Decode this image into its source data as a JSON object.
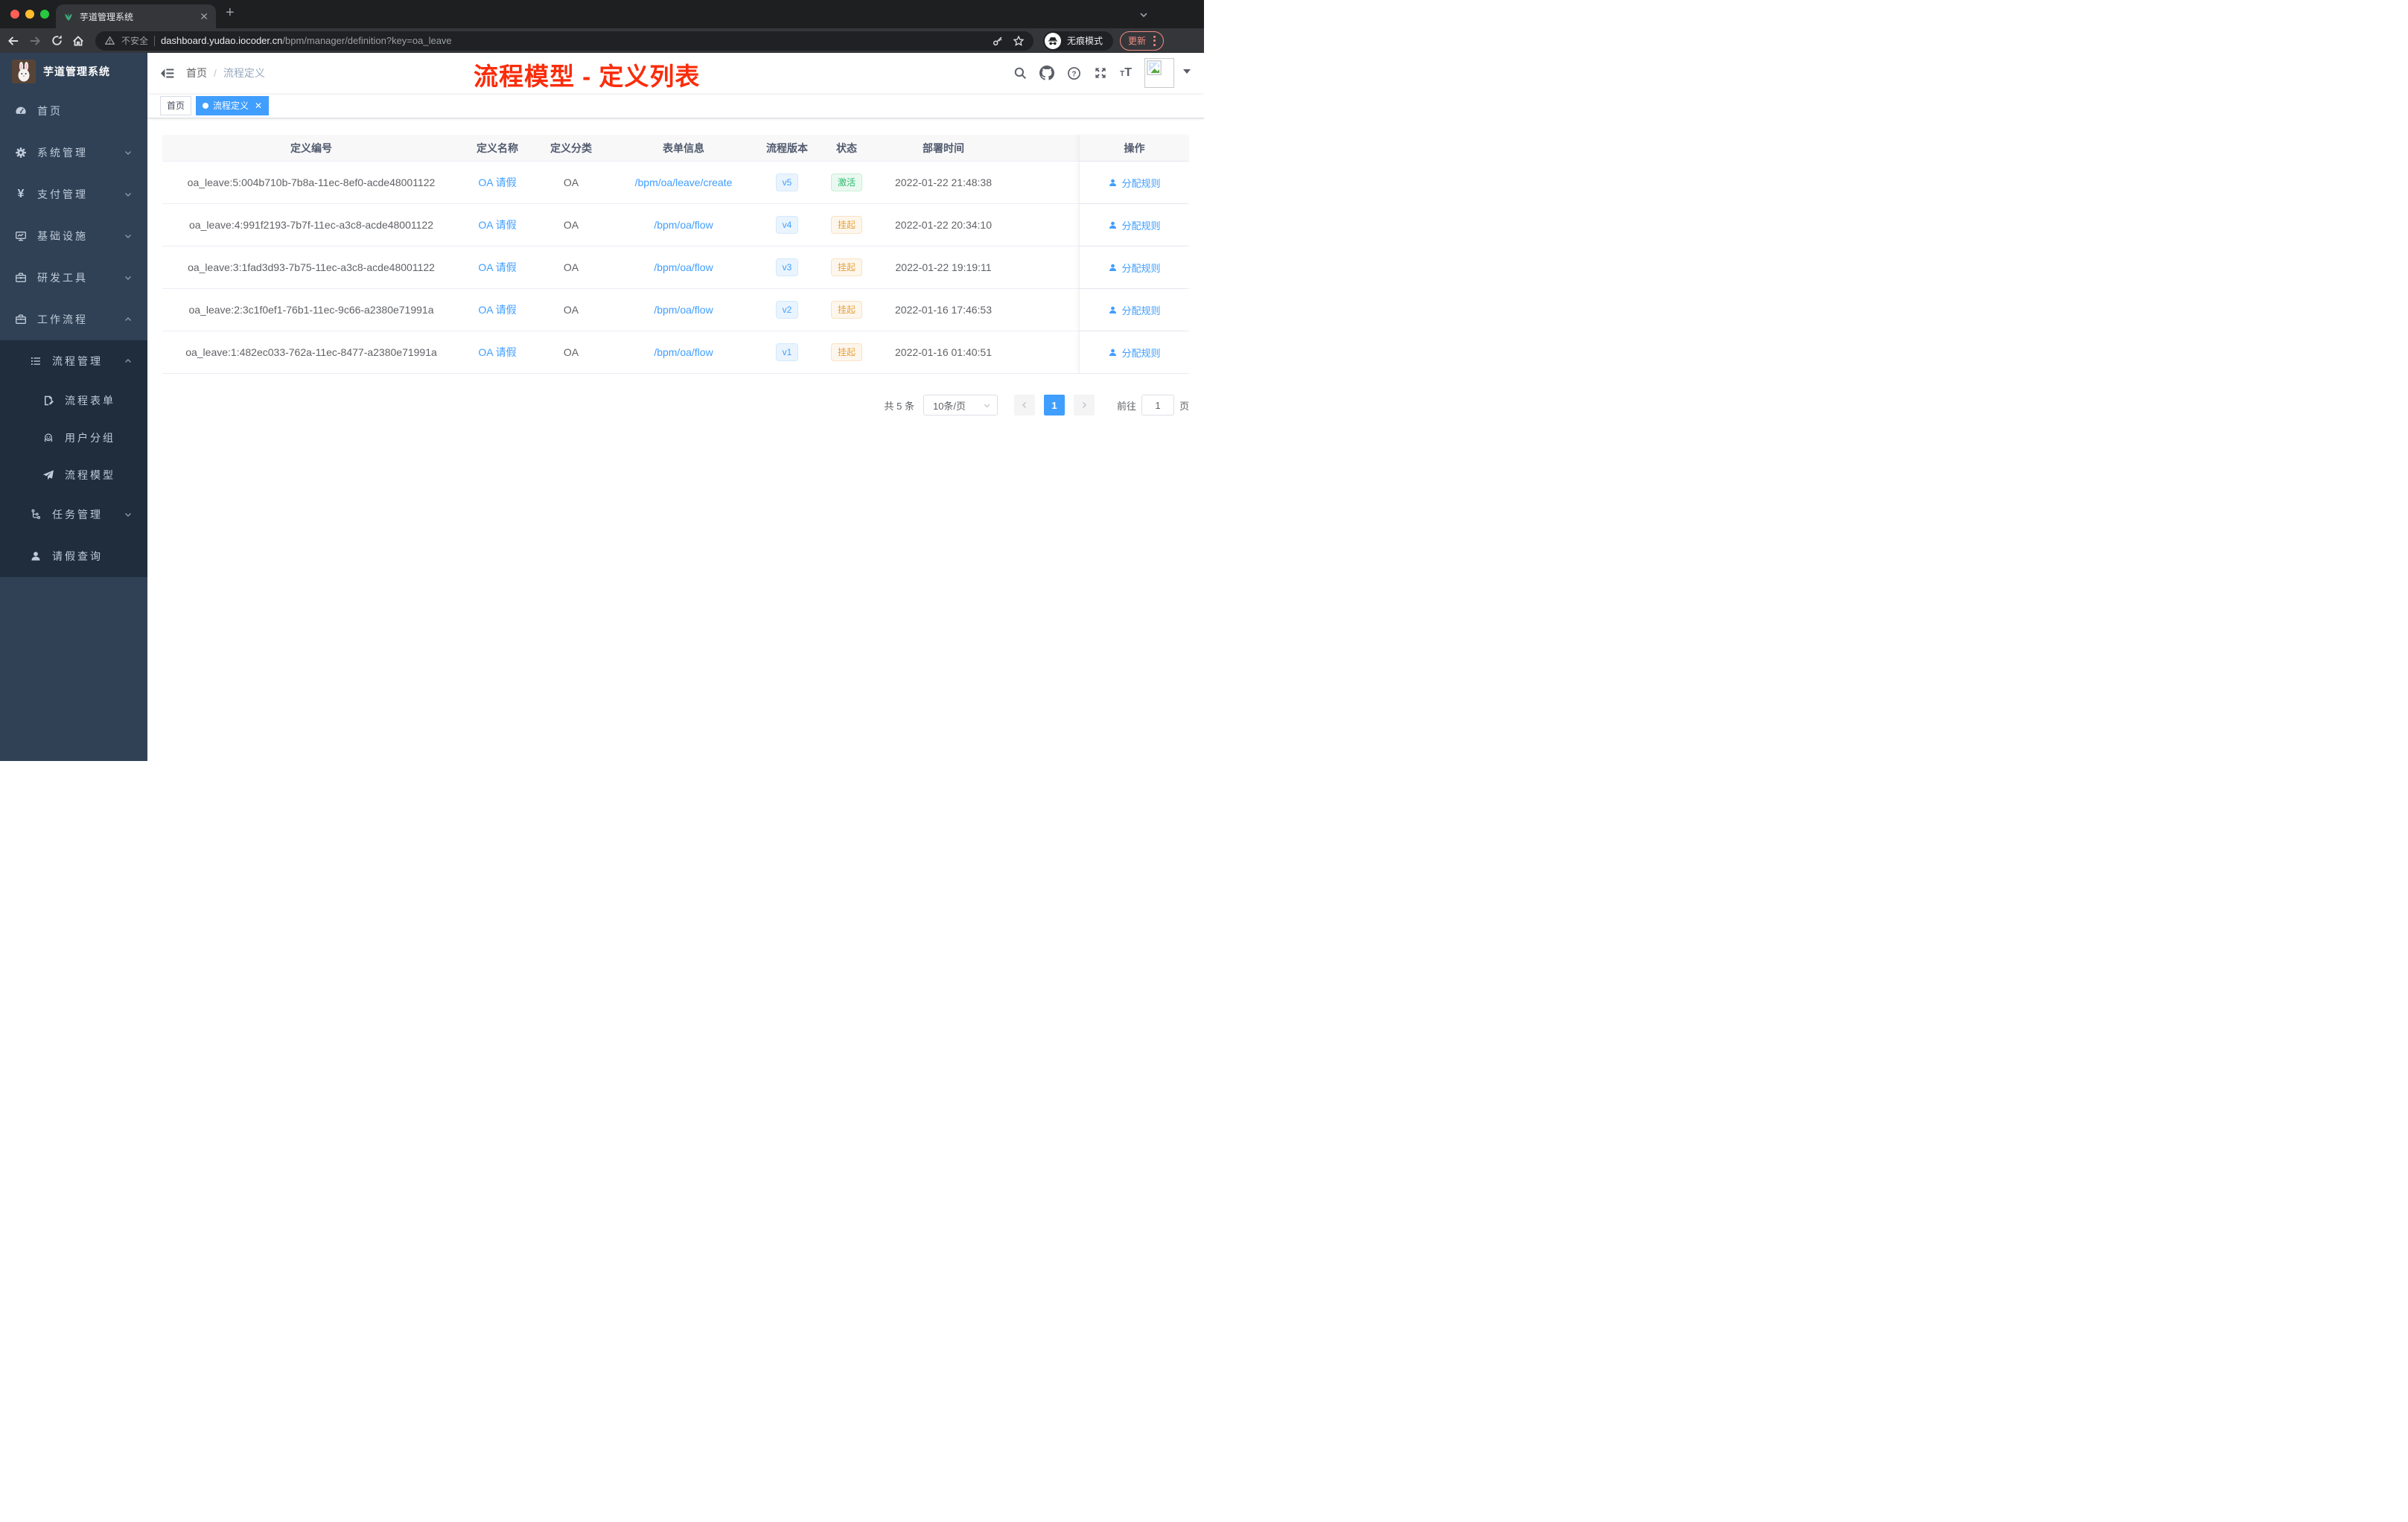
{
  "browser": {
    "tab_title": "芋道管理系统",
    "security_label": "不安全",
    "url_host": "dashboard.yudao.iocoder.cn",
    "url_path": "/bpm/manager/definition?key=oa_leave",
    "incognito_label": "无痕模式",
    "update_label": "更新"
  },
  "sidebar": {
    "title": "芋道管理系统",
    "items": [
      {
        "label": "首页",
        "icon": "dashboard-icon",
        "level": 0
      },
      {
        "label": "系统管理",
        "icon": "gear-icon",
        "level": 0,
        "arrow": "down"
      },
      {
        "label": "支付管理",
        "icon": "yen-icon",
        "level": 0,
        "arrow": "down"
      },
      {
        "label": "基础设施",
        "icon": "monitor-icon",
        "level": 0,
        "arrow": "down"
      },
      {
        "label": "研发工具",
        "icon": "toolbox-icon",
        "level": 0,
        "arrow": "down"
      },
      {
        "label": "工作流程",
        "icon": "briefcase-icon",
        "level": 0,
        "arrow": "up"
      },
      {
        "label": "流程管理",
        "icon": "list-icon",
        "level": 1,
        "arrow": "up"
      },
      {
        "label": "流程表单",
        "icon": "form-icon",
        "level": 2
      },
      {
        "label": "用户分组",
        "icon": "robot-icon",
        "level": 2
      },
      {
        "label": "流程模型",
        "icon": "send-icon",
        "level": 2
      },
      {
        "label": "任务管理",
        "icon": "tree-icon",
        "level": 1,
        "arrow": "down"
      },
      {
        "label": "请假查询",
        "icon": "user-icon",
        "level": 1
      }
    ]
  },
  "navbar": {
    "breadcrumb": [
      "首页",
      "流程定义"
    ],
    "annotation": "流程模型 - 定义列表"
  },
  "tags_view": {
    "tags": [
      {
        "label": "首页",
        "active": false
      },
      {
        "label": "流程定义",
        "active": true,
        "closable": true
      }
    ]
  },
  "table": {
    "headers": [
      "定义编号",
      "定义名称",
      "定义分类",
      "表单信息",
      "流程版本",
      "状态",
      "部署时间",
      "操作"
    ],
    "rows": [
      {
        "id": "oa_leave:5:004b710b-7b8a-11ec-8ef0-acde48001122",
        "name": "OA 请假",
        "category": "OA",
        "form": "/bpm/oa/leave/create",
        "version": "v5",
        "status": "激活",
        "status_type": "success",
        "time": "2022-01-22 21:48:38",
        "action": "分配规则"
      },
      {
        "id": "oa_leave:4:991f2193-7b7f-11ec-a3c8-acde48001122",
        "name": "OA 请假",
        "category": "OA",
        "form": "/bpm/oa/flow",
        "version": "v4",
        "status": "挂起",
        "status_type": "warning",
        "time": "2022-01-22 20:34:10",
        "action": "分配规则"
      },
      {
        "id": "oa_leave:3:1fad3d93-7b75-11ec-a3c8-acde48001122",
        "name": "OA 请假",
        "category": "OA",
        "form": "/bpm/oa/flow",
        "version": "v3",
        "status": "挂起",
        "status_type": "warning",
        "time": "2022-01-22 19:19:11",
        "action": "分配规则"
      },
      {
        "id": "oa_leave:2:3c1f0ef1-76b1-11ec-9c66-a2380e71991a",
        "name": "OA 请假",
        "category": "OA",
        "form": "/bpm/oa/flow",
        "version": "v2",
        "status": "挂起",
        "status_type": "warning",
        "time": "2022-01-16 17:46:53",
        "action": "分配规则"
      },
      {
        "id": "oa_leave:1:482ec033-762a-11ec-8477-a2380e71991a",
        "name": "OA 请假",
        "category": "OA",
        "form": "/bpm/oa/flow",
        "version": "v1",
        "status": "挂起",
        "status_type": "warning",
        "time": "2022-01-16 01:40:51",
        "action": "分配规则"
      }
    ]
  },
  "pagination": {
    "total": "共 5 条",
    "page_size": "10条/页",
    "current_page": "1",
    "goto_label": "前往",
    "goto_value": "1",
    "goto_unit": "页"
  },
  "colors": {
    "accent": "#409eff",
    "annotation": "#fa2c0a",
    "sidebar_bg": "#304156",
    "submenu_bg": "#1f2d3d",
    "success": "#2bb96b",
    "warning": "#e6a23c"
  }
}
